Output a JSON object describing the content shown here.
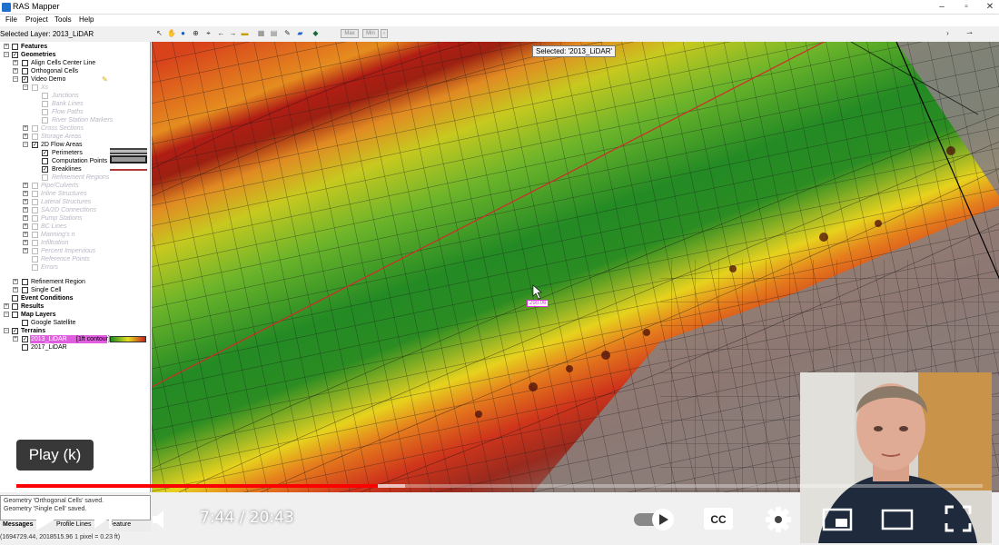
{
  "window": {
    "title": "RAS Mapper",
    "controls": [
      "–",
      "▫",
      "✕"
    ]
  },
  "menu": {
    "items": [
      "File",
      "Project",
      "Tools",
      "Help"
    ]
  },
  "selected_layer": "Selected Layer: 2013_LiDAR",
  "toolbar": {
    "max_label": "Max",
    "min_label": "Min"
  },
  "tree": {
    "features": "Features",
    "geometries": "Geometries",
    "align_cells": "Align Cells Center Line",
    "orthogonal_cells": "Orthogonal Cells",
    "video_demo": "Video Demo",
    "xs": "Xs",
    "junctions": "Junctions",
    "bank_lines": "Bank Lines",
    "flow_paths": "Flow Paths",
    "river_station_markers": "River Station Markers",
    "cross_sections": "Cross Sections",
    "storage_areas": "Storage Areas",
    "flow_areas_2d": "2D Flow Areas",
    "perimeters": "Perimeters",
    "computation_points": "Computation Points",
    "breaklines": "Breaklines",
    "refinement_regions_dim": "Refinement Regions",
    "pipe_culverts": "Pipe/Culverts",
    "inline_structures": "Inline Structures",
    "lateral_structures": "Lateral Structures",
    "sa2d_connections": "SA/2D Connections",
    "pump_stations": "Pump Stations",
    "bc_lines": "BC Lines",
    "mannings_n": "Manning's n",
    "infiltration": "Infiltration",
    "percent_impervious": "Percent Impervious",
    "reference_points": "Reference Points",
    "errors": "Errors",
    "refinement_region": "Refinement Region",
    "single_cell": "Single Cell",
    "event_conditions": "Event Conditions",
    "results": "Results",
    "map_layers": "Map Layers",
    "google_satellite": "Google Satellite",
    "terrains": "Terrains",
    "lidar_2013": "2013_LiDAR",
    "contour_tag": "[1ft contour]",
    "lidar_2017": "2017_LiDAR"
  },
  "messages": {
    "line1": "Geometry 'Orthogonal Cells' saved.",
    "line2": "Geometry 'Single Cell' saved."
  },
  "tabs": [
    "Messages",
    "Profile Lines",
    "Feature"
  ],
  "coords": "(1694729.44, 2018515.96  1 pixel = 0.23 ft)",
  "map": {
    "selected_tip": "Selected: '2013_LiDAR'",
    "elev_tip": "290.06"
  },
  "player": {
    "play_tooltip": "Play (k)",
    "current_time": "7:44",
    "duration": "20:43",
    "timecode": "7:44 / 20:43",
    "progress_played": 0.374,
    "progress_loaded": 0.402,
    "accent": "#ff0000"
  },
  "colors": {
    "terrain_low": "#1e8c1e",
    "terrain_mid": "#e6e01e",
    "terrain_high": "#c81e1e",
    "contour_line": "#1a1a1a",
    "breakline": "#d22a2a"
  }
}
